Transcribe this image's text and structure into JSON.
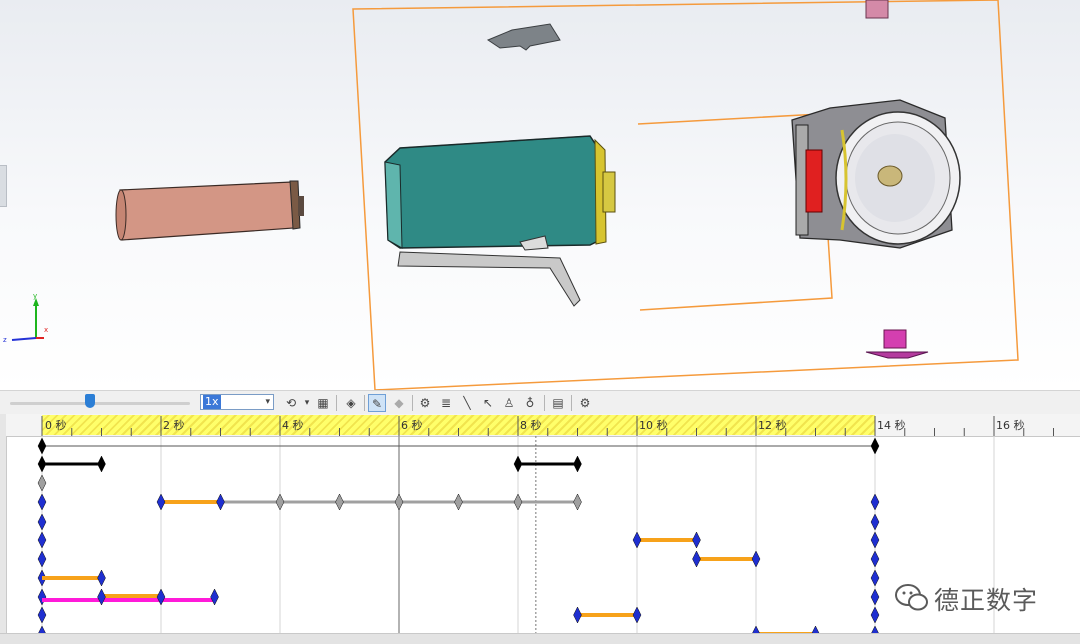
{
  "toolbar": {
    "playback_speed": "1x"
  },
  "timeline": {
    "unit": "秒",
    "ticks": [
      {
        "label": "0 秒"
      },
      {
        "label": "2 秒"
      },
      {
        "label": "4 秒"
      },
      {
        "label": "6 秒"
      },
      {
        "label": "8 秒"
      },
      {
        "label": "10 秒"
      },
      {
        "label": "12 秒"
      },
      {
        "label": "14 秒"
      },
      {
        "label": "16 秒"
      }
    ]
  },
  "viewport": {
    "triad_axes": [
      "y",
      "x",
      "z"
    ]
  },
  "watermark": {
    "text": "德正数字"
  },
  "colors": {
    "key_blue": "#1f2fd0",
    "bar_orange": "#f7a21a",
    "bar_magenta": "#ff1ad9",
    "bar_black": "#000000",
    "bar_gray": "#a0a0a0",
    "ruler_yellow": "#ffff6a"
  }
}
